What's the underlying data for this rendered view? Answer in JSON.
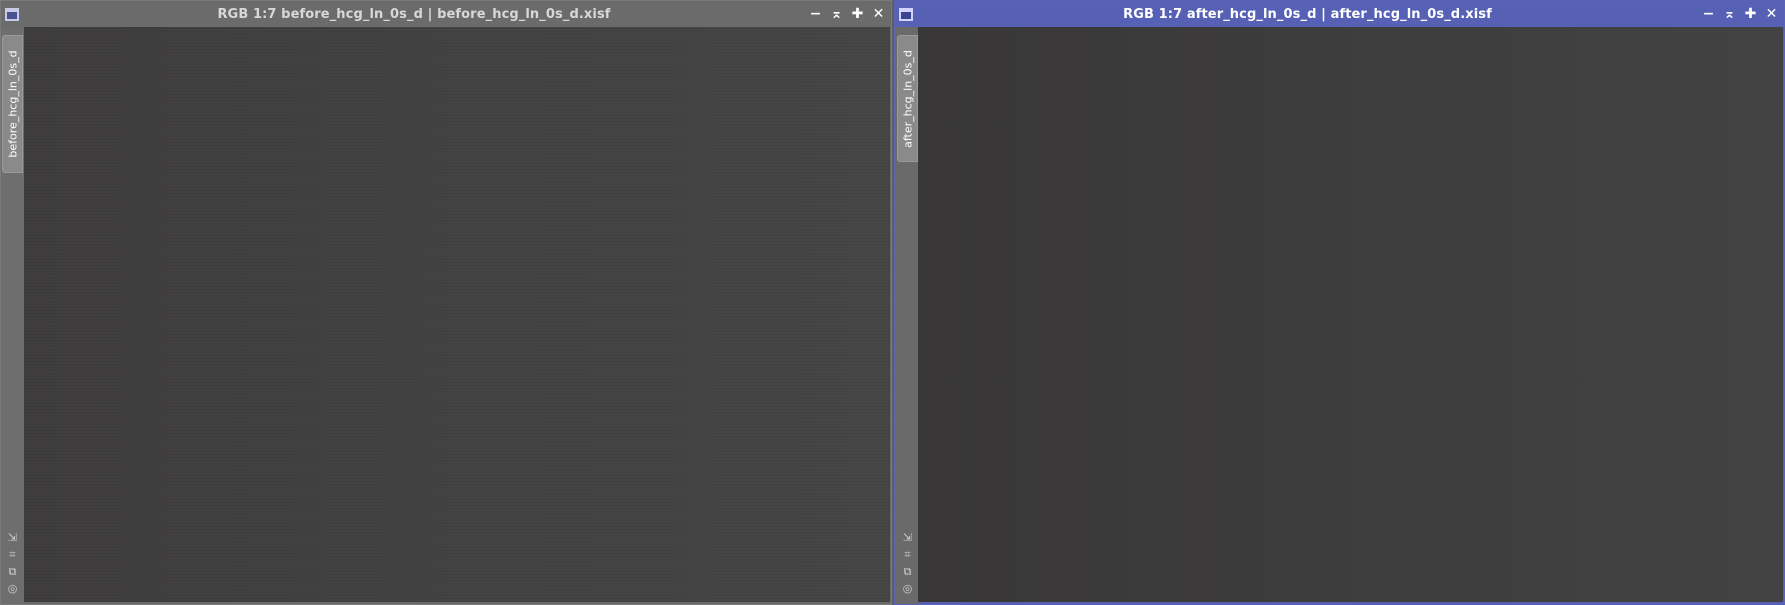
{
  "windows": [
    {
      "title": "RGB 1:7 before_hcg_ln_0s_d | before_hcg_ln_0s_d.xisf",
      "tab_label": "before_hcg_ln_0s_d",
      "active": false
    },
    {
      "title": "RGB 1:7 after_hcg_ln_0s_d | after_hcg_ln_0s_d.xisf",
      "tab_label": "after_hcg_ln_0s_d",
      "active": true
    }
  ],
  "controls": {
    "minimize": "−",
    "shade": "⌅",
    "maximize": "✚",
    "close": "✕"
  },
  "side_icons": [
    "⇲",
    "⌗",
    "⧉",
    "◎"
  ],
  "icons": {
    "window": "window-icon",
    "minimize": "minimize-icon",
    "shade": "shade-icon",
    "maximize": "maximize-icon",
    "close": "close-icon",
    "side": [
      "fit-view-icon",
      "zoom-icon",
      "clone-icon",
      "mask-icon"
    ]
  },
  "colors": {
    "active_titlebar": "#5661b5",
    "inactive_titlebar": "#6b6b6b",
    "image_background": "#404040"
  }
}
